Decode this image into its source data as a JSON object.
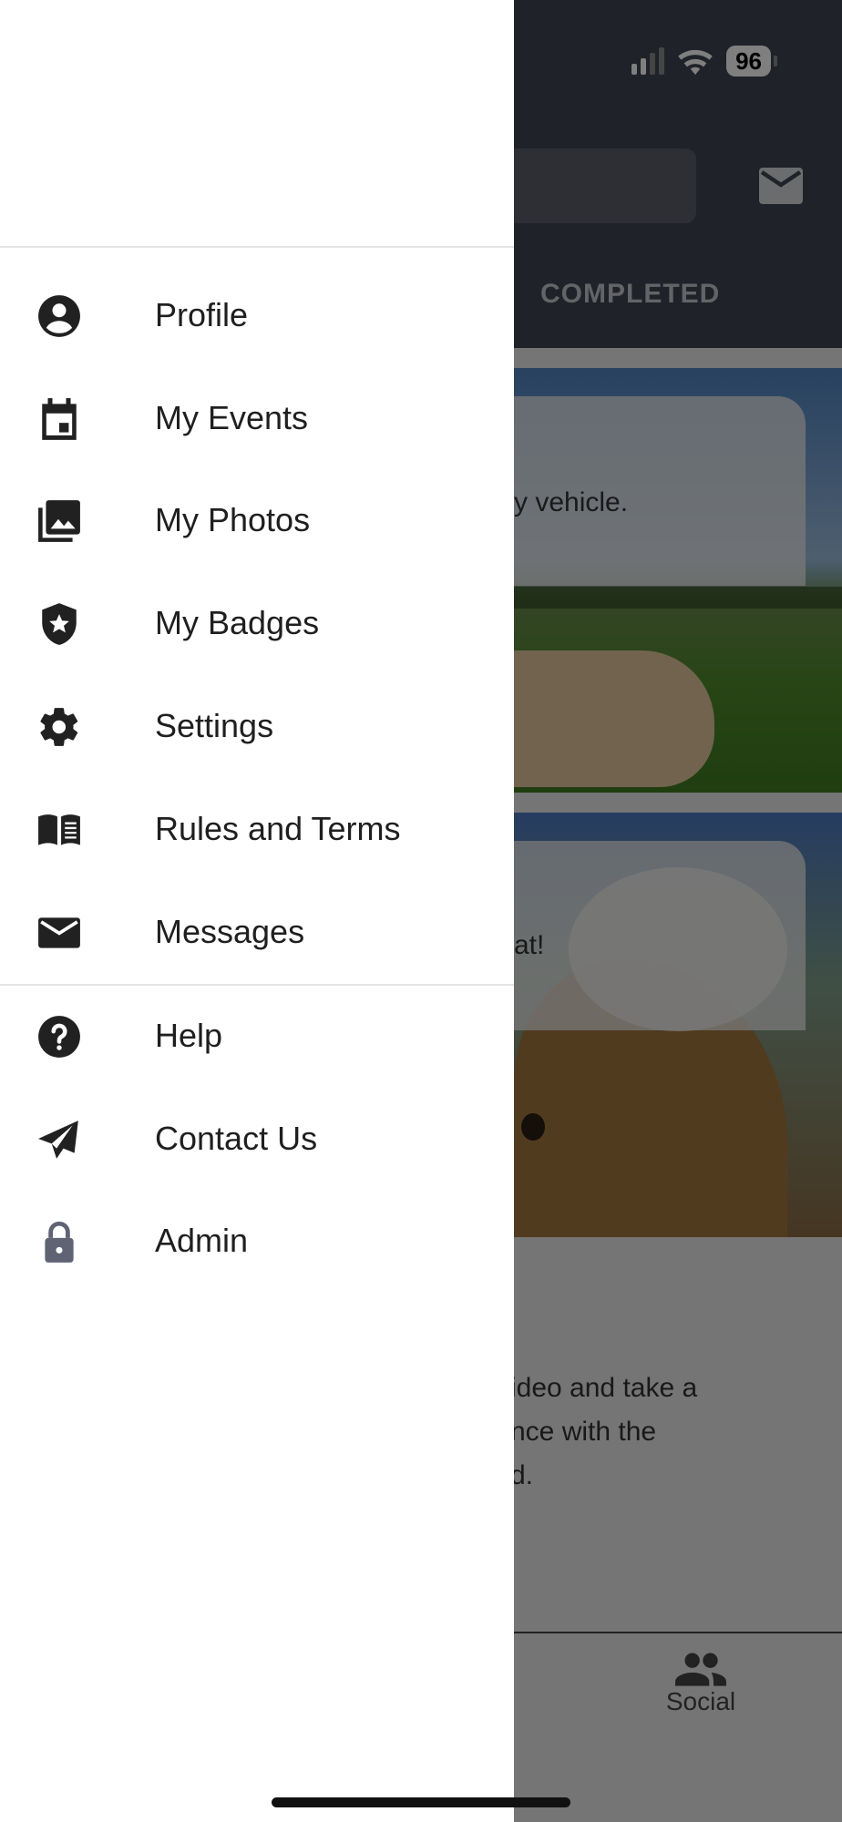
{
  "status_bar": {
    "battery": "96"
  },
  "background_app": {
    "tab_completed": "COMPLETED",
    "card1_text": "y vehicle.",
    "card2_text": "at!",
    "paragraph": [
      "ideo and take a",
      "nce with the",
      "d."
    ],
    "bottom_nav_social": "Social"
  },
  "drawer": {
    "items": [
      {
        "label": "Profile",
        "icon": "account-circle-icon"
      },
      {
        "label": "My Events",
        "icon": "calendar-icon"
      },
      {
        "label": "My Photos",
        "icon": "photo-library-icon"
      },
      {
        "label": "My Badges",
        "icon": "shield-star-icon"
      },
      {
        "label": "Settings",
        "icon": "gear-icon"
      },
      {
        "label": "Rules and Terms",
        "icon": "book-icon"
      },
      {
        "label": "Messages",
        "icon": "mail-icon"
      },
      {
        "label": "Help",
        "icon": "help-circle-icon"
      },
      {
        "label": "Contact Us",
        "icon": "send-icon"
      },
      {
        "label": "Admin",
        "icon": "lock-icon"
      }
    ]
  },
  "colors": {
    "drawer_text": "#1f1f1f",
    "icon": "#212121",
    "scrim": "rgba(0,0,0,0.5)",
    "appbar": "#3f4451"
  }
}
